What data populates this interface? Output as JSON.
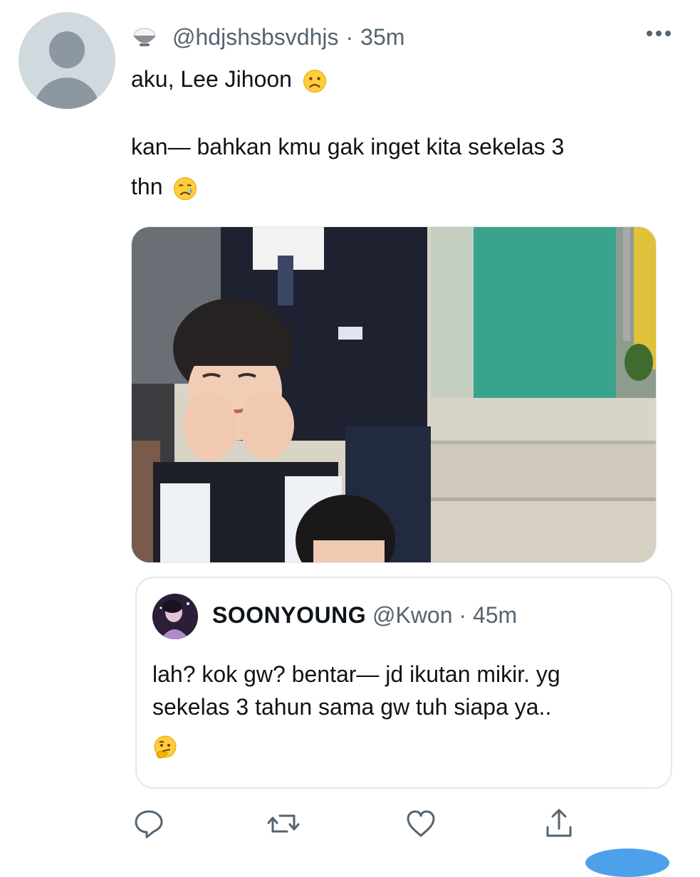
{
  "tweet": {
    "author_handle": "@hdjshsbsvdhjs",
    "separator": "·",
    "time": "35m",
    "line1": "aku, Lee Jihoon",
    "line1_emoji": "slightly-frowning-face-emoji",
    "line2": "kan— bahkan kmu gak inget kita sekelas 3",
    "line3": "thn",
    "line3_emoji": "crying-face-emoji",
    "media": "photo of students in school uniforms sitting on steps"
  },
  "quoted_tweet": {
    "author_name": "SOONYOUNG",
    "author_handle": "@Kwon",
    "separator": "·",
    "time": "45m",
    "line1": "lah? kok gw? bentar— jd ikutan mikir. yg",
    "line2": "sekelas 3 tahun sama gw tuh siapa ya..",
    "emoji": "thinking-face-emoji"
  },
  "icons": {
    "header": [
      "rice-bowl-icon",
      "more-icon"
    ],
    "actions": [
      "reply-icon",
      "retweet-icon",
      "like-icon",
      "share-icon"
    ]
  },
  "colors": {
    "text": "#0f1419",
    "secondary": "#536471",
    "border": "#e1e8ed",
    "avatar_bg": "#cfd9de"
  }
}
